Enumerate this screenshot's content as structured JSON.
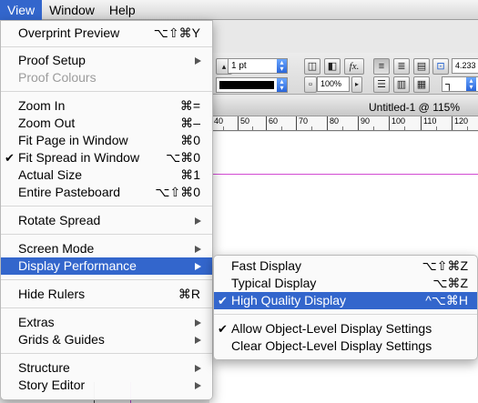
{
  "menubar": {
    "items": [
      "View",
      "Window",
      "Help"
    ]
  },
  "view_menu": {
    "items": [
      {
        "label": "Overprint Preview",
        "shortcut": "⌥⇧⌘Y"
      },
      {
        "label": "Proof Setup"
      },
      {
        "label": "Proof Colours"
      },
      {
        "label": "Zoom In",
        "shortcut": "⌘="
      },
      {
        "label": "Zoom Out",
        "shortcut": "⌘–"
      },
      {
        "label": "Fit Page in Window",
        "shortcut": "⌘0"
      },
      {
        "label": "Fit Spread in Window",
        "shortcut": "⌥⌘0",
        "check": "✔"
      },
      {
        "label": "Actual Size",
        "shortcut": "⌘1"
      },
      {
        "label": "Entire Pasteboard",
        "shortcut": "⌥⇧⌘0"
      },
      {
        "label": "Rotate Spread"
      },
      {
        "label": "Screen Mode"
      },
      {
        "label": "Display Performance"
      },
      {
        "label": "Hide Rulers",
        "shortcut": "⌘R"
      },
      {
        "label": "Extras"
      },
      {
        "label": "Grids & Guides"
      },
      {
        "label": "Structure"
      },
      {
        "label": "Story Editor"
      }
    ]
  },
  "perf_menu": {
    "items": [
      {
        "label": "Fast Display",
        "shortcut": "⌥⇧⌘Z"
      },
      {
        "label": "Typical Display",
        "shortcut": "⌥⌘Z"
      },
      {
        "label": "High Quality Display",
        "shortcut": "^⌥⌘H",
        "check": "✔"
      },
      {
        "label": "Allow Object-Level Display Settings",
        "check": "✔"
      },
      {
        "label": "Clear Object-Level Display Settings"
      }
    ]
  },
  "toolbar": {
    "stroke_weight": "1 pt",
    "zoom_percent": "100%",
    "fx_label": "fx.",
    "ref_value": "4.233"
  },
  "document": {
    "title": "Untitled-1 @ 115%",
    "ruler_labels": [
      "40",
      "50",
      "60",
      "70",
      "80",
      "90",
      "100",
      "110",
      "120"
    ]
  }
}
